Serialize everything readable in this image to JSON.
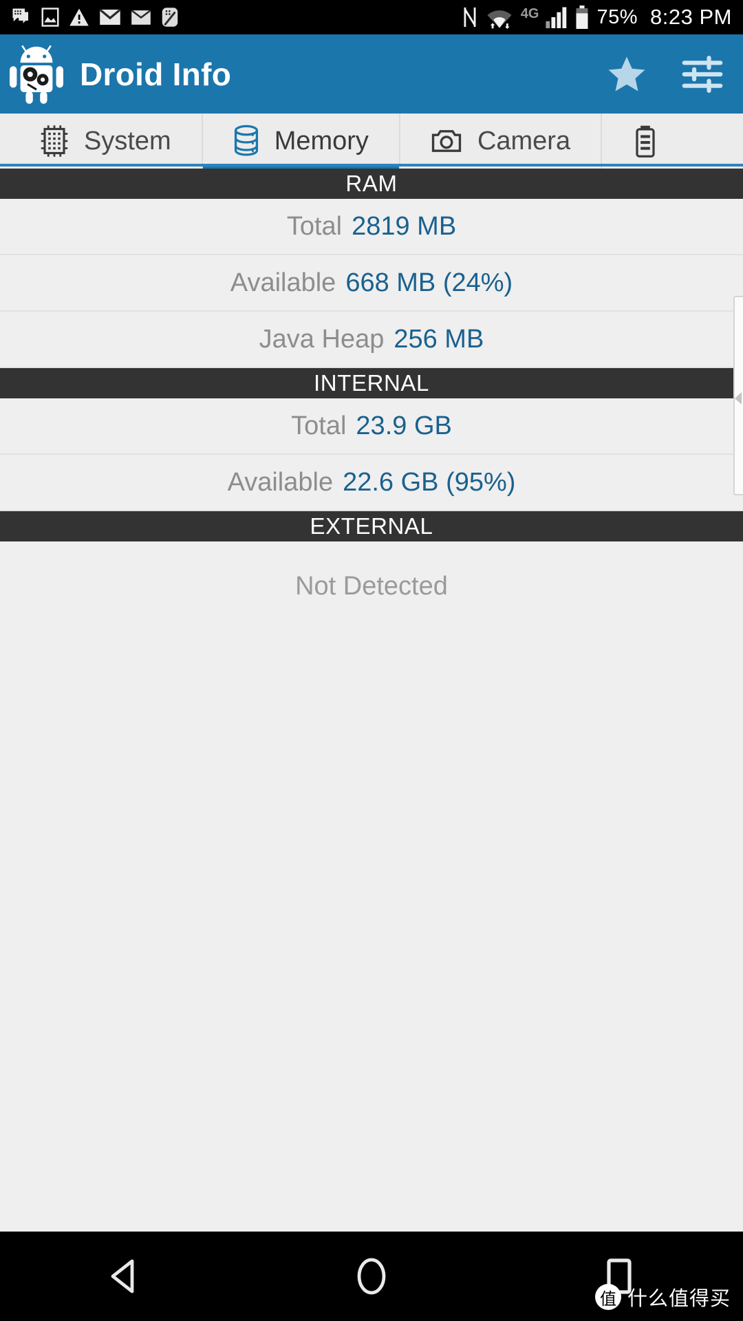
{
  "status_bar": {
    "left_icons": [
      "message-icon",
      "image-icon",
      "warning-icon",
      "mail-filled-icon",
      "mail-outline-icon",
      "app-notification-icon"
    ],
    "right_icons": [
      "nfc-icon",
      "wifi-icon",
      "signal-icon",
      "battery-icon"
    ],
    "network_type": "4G",
    "battery_percent": "75%",
    "time": "8:23 PM"
  },
  "app_bar": {
    "title": "Droid Info",
    "logo_icon": "android-gears-logo",
    "star_icon": "star-icon",
    "tune_icon": "tune-sliders-icon",
    "background_color": "#1b76ac"
  },
  "tabs": [
    {
      "label": "System",
      "icon": "cpu-chip-icon",
      "active": false
    },
    {
      "label": "Memory",
      "icon": "database-icon",
      "active": true
    },
    {
      "label": "Camera",
      "icon": "camera-icon",
      "active": false
    },
    {
      "label": "",
      "icon": "battery-tab-icon",
      "active": false
    }
  ],
  "sections": [
    {
      "title": "RAM",
      "rows": [
        {
          "label": "Total",
          "value": "2819 MB"
        },
        {
          "label": "Available",
          "value": "668 MB (24%)"
        },
        {
          "label": "Java Heap",
          "value": "256 MB"
        }
      ]
    },
    {
      "title": "INTERNAL",
      "rows": [
        {
          "label": "Total",
          "value": "23.9 GB"
        },
        {
          "label": "Available",
          "value": "22.6 GB (95%)"
        }
      ]
    },
    {
      "title": "EXTERNAL",
      "empty_text": "Not Detected",
      "rows": []
    }
  ],
  "nav_bar": {
    "back_icon": "back-triangle-icon",
    "home_icon": "home-circle-icon",
    "recents_icon": "recents-square-icon"
  },
  "watermark": {
    "mark": "值",
    "text": "什么值得买"
  },
  "colors": {
    "accent": "#1b76ac",
    "value_text": "#1a618f",
    "label_text": "#8d8d8d",
    "section_bg": "#333333",
    "page_bg": "#efefef"
  }
}
